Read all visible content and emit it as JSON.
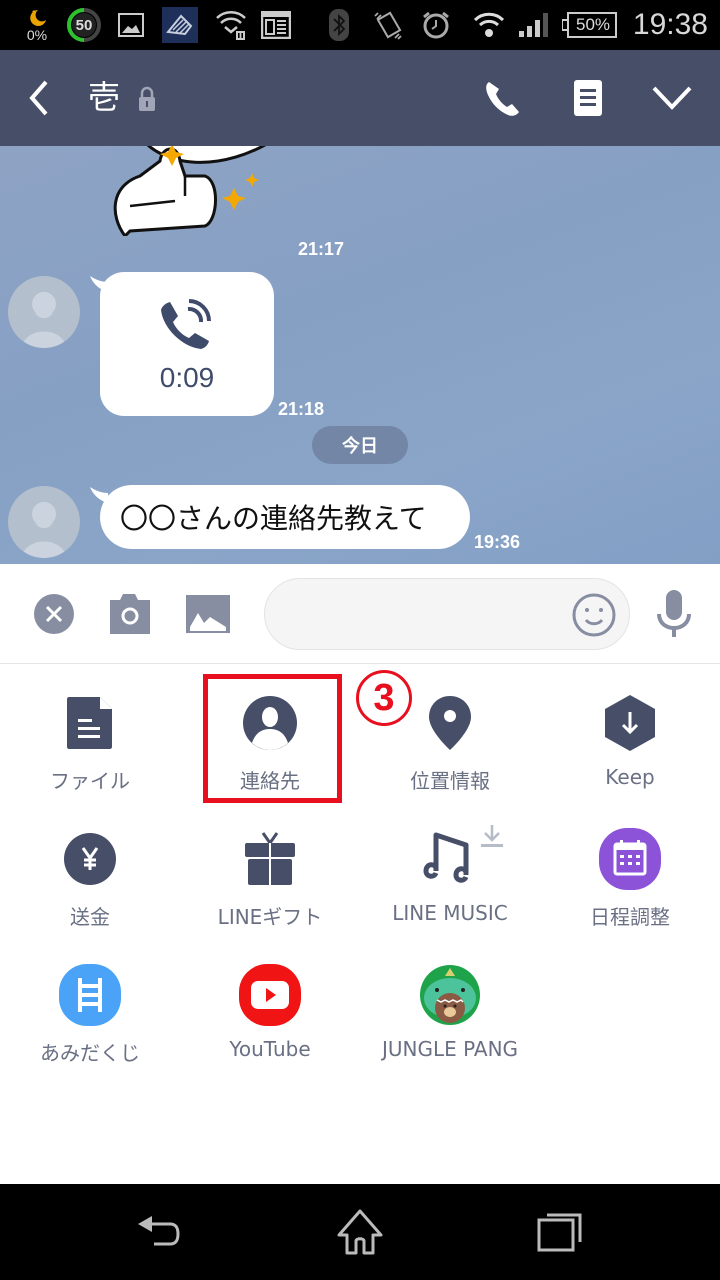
{
  "status_bar": {
    "battery_saver_label": "0%",
    "data_counter": "50",
    "battery_percent": "50%",
    "time": "19:38",
    "icons": [
      "moon-icon",
      "data-counter-icon",
      "image-icon",
      "app-notification-icon",
      "wifi-paused-icon",
      "news-icon",
      "bluetooth-icon",
      "vibrate-icon",
      "alarm-icon",
      "wifi-icon",
      "signal-icon",
      "battery-icon"
    ]
  },
  "header": {
    "title": "壱",
    "back_icon": "chevron-left-icon",
    "lock_icon": "lock-icon",
    "call_icon": "phone-icon",
    "notes_icon": "notes-icon",
    "menu_icon": "chevron-down-icon",
    "bg_color": "#474f68"
  },
  "chat": {
    "messages": [
      {
        "type": "sticker",
        "sender": "me",
        "time": "21:17"
      },
      {
        "type": "call",
        "sender": "other",
        "duration": "0:09",
        "time": "21:18"
      },
      {
        "type": "date",
        "label": "今日"
      },
      {
        "type": "text",
        "sender": "other",
        "text": "〇〇さんの連絡先教えて",
        "time": "19:36"
      }
    ]
  },
  "input_bar": {
    "close_icon": "close-circle-icon",
    "camera_icon": "camera-icon",
    "image_icon": "image-icon",
    "placeholder": "",
    "emoji_icon": "smiley-icon",
    "mic_icon": "mic-icon"
  },
  "menu": {
    "items": [
      {
        "label": "ファイル",
        "icon": "file-icon"
      },
      {
        "label": "連絡先",
        "icon": "contact-icon"
      },
      {
        "label": "位置情報",
        "icon": "location-pin-icon"
      },
      {
        "label": "Keep",
        "icon": "keep-icon"
      },
      {
        "label": "送金",
        "icon": "yen-icon"
      },
      {
        "label": "LINEギフト",
        "icon": "gift-icon"
      },
      {
        "label": "LINE MUSIC",
        "icon": "music-note-icon"
      },
      {
        "label": "日程調整",
        "icon": "calendar-icon"
      },
      {
        "label": "あみだくじ",
        "icon": "ladder-icon"
      },
      {
        "label": "YouTube",
        "icon": "youtube-icon"
      },
      {
        "label": "JUNGLE PANG",
        "icon": "jungle-pang-icon"
      }
    ],
    "annotation_number": "3",
    "highlight_color": "#e8101e",
    "accent_purple": "#8c52d8",
    "accent_blue": "#4aa3f7",
    "youtube_red": "#f01414"
  },
  "nav_bar": {
    "back": "back-icon",
    "home": "home-icon",
    "recents": "recents-icon"
  }
}
